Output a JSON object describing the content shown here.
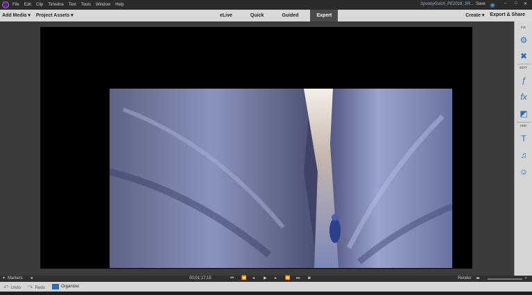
{
  "menubar": {
    "items": [
      "File",
      "Edit",
      "Clip",
      "Timeline",
      "Text",
      "Tools",
      "Window",
      "Help"
    ],
    "document_name": "SpookyGulch_PE2018_SR...",
    "save_label": "Save"
  },
  "modebar": {
    "add_media": "Add Media ▾",
    "project_assets": "Project Assets ▾",
    "tabs": [
      "eLive",
      "Quick",
      "Guided",
      "Expert"
    ],
    "active_tab": "Expert",
    "create": "Create ▾",
    "export": "Export & Share"
  },
  "panel": {
    "sections": [
      "FIX",
      "EDIT",
      "ADD"
    ],
    "icons": [
      "adjustments-icon",
      "tools-icon",
      "effects-icon",
      "fx-icon",
      "transitions-icon",
      "titles-icon",
      "music-icon",
      "graphics-icon"
    ]
  },
  "transport": {
    "markers_label": "Markers",
    "timecode": "00;01;17;15",
    "render_label": "Render"
  },
  "bottombar": {
    "undo": "Undo",
    "redo": "Redo",
    "organizer": "Organizer"
  },
  "colors": {
    "accent_blue": "#2b6cb8",
    "active_tab_bg": "#4a4a4a",
    "toolbar_bg": "#d9d9d9"
  }
}
